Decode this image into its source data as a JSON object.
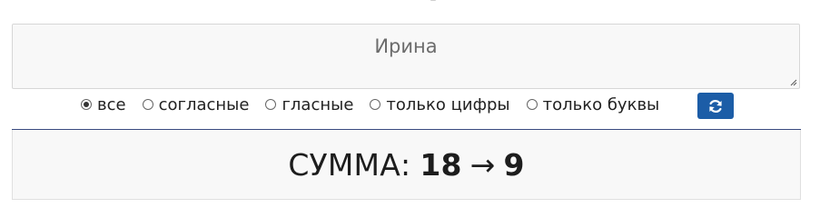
{
  "input": {
    "value": "Ирина"
  },
  "filters": {
    "selected": "все",
    "options": [
      {
        "label": "все",
        "checked": true
      },
      {
        "label": "согласные",
        "checked": false
      },
      {
        "label": "гласные",
        "checked": false
      },
      {
        "label": "только цифры",
        "checked": false
      },
      {
        "label": "только буквы",
        "checked": false
      }
    ]
  },
  "refresh_button": {
    "icon": "refresh-icon",
    "color": "#1c5da7"
  },
  "result": {
    "label": "СУММА:",
    "sum": "18",
    "arrow": "→",
    "reduced": "9"
  }
}
